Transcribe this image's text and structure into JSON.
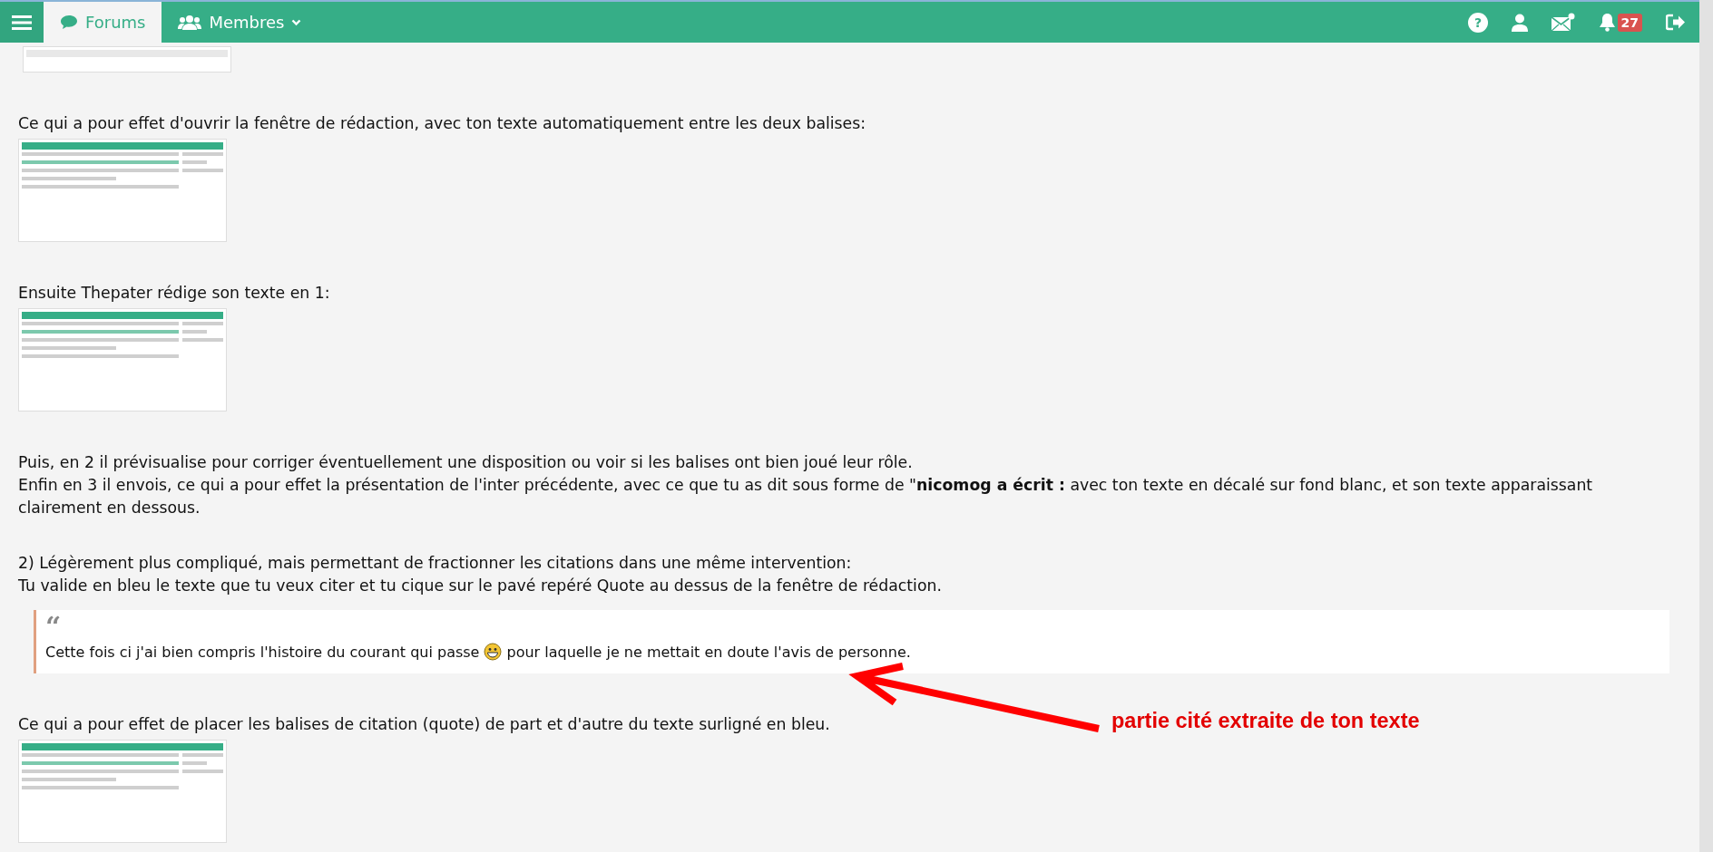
{
  "top_bar": {
    "tabs": [
      {
        "label": "Forums",
        "selected": true,
        "dropdown": false
      },
      {
        "label": "Membres",
        "selected": false,
        "dropdown": true
      }
    ],
    "help_glyph": "?",
    "notification_count": "27"
  },
  "content": [
    {
      "kind": "image"
    },
    {
      "kind": "text",
      "lines": [
        "Ce qui a pour effet d'ouvrir la fenêtre de rédaction, avec ton texte automatiquement entre les deux balises:"
      ]
    },
    {
      "kind": "image"
    },
    {
      "kind": "text",
      "lines": [
        "Ensuite Thepater rédige son texte en 1:"
      ]
    },
    {
      "kind": "image"
    },
    {
      "kind": "text",
      "lines": [
        "Puis, en 2 il prévisualise pour corriger éventuellement une disposition ou voir si les balises ont bien joué leur rôle.",
        "Enfin en 3 il envois, ce qui a pour effet la présentation de l'inter précédente, avec ce que tu as dit sous forme de \"**nicomog a écrit :** avec ton texte en décalé sur fond blanc, et son texte apparaissant clairement en dessous."
      ]
    },
    {
      "kind": "text",
      "lines": [
        "2) Légèrement plus compliqué, mais permettant de fractionner les citations dans une même intervention:",
        "Tu valide en bleu le texte que tu veux citer et tu cique sur le pavé repéré Quote au dessus de la fenêtre de rédaction."
      ]
    },
    {
      "kind": "quote",
      "mark": "“",
      "text_before": "Cette fois ci j'ai bien compris l'histoire du courant qui passe",
      "text_after": "pour laquelle je ne mettait en doute l'avis de personne."
    },
    {
      "kind": "text",
      "lines": [
        "Ce qui a pour effet de placer les balises de citation (quote) de part et d'autre du texte surligné en bleu."
      ]
    },
    {
      "kind": "image"
    }
  ],
  "annotation": {
    "text": "partie cité extraite de ton texte"
  }
}
